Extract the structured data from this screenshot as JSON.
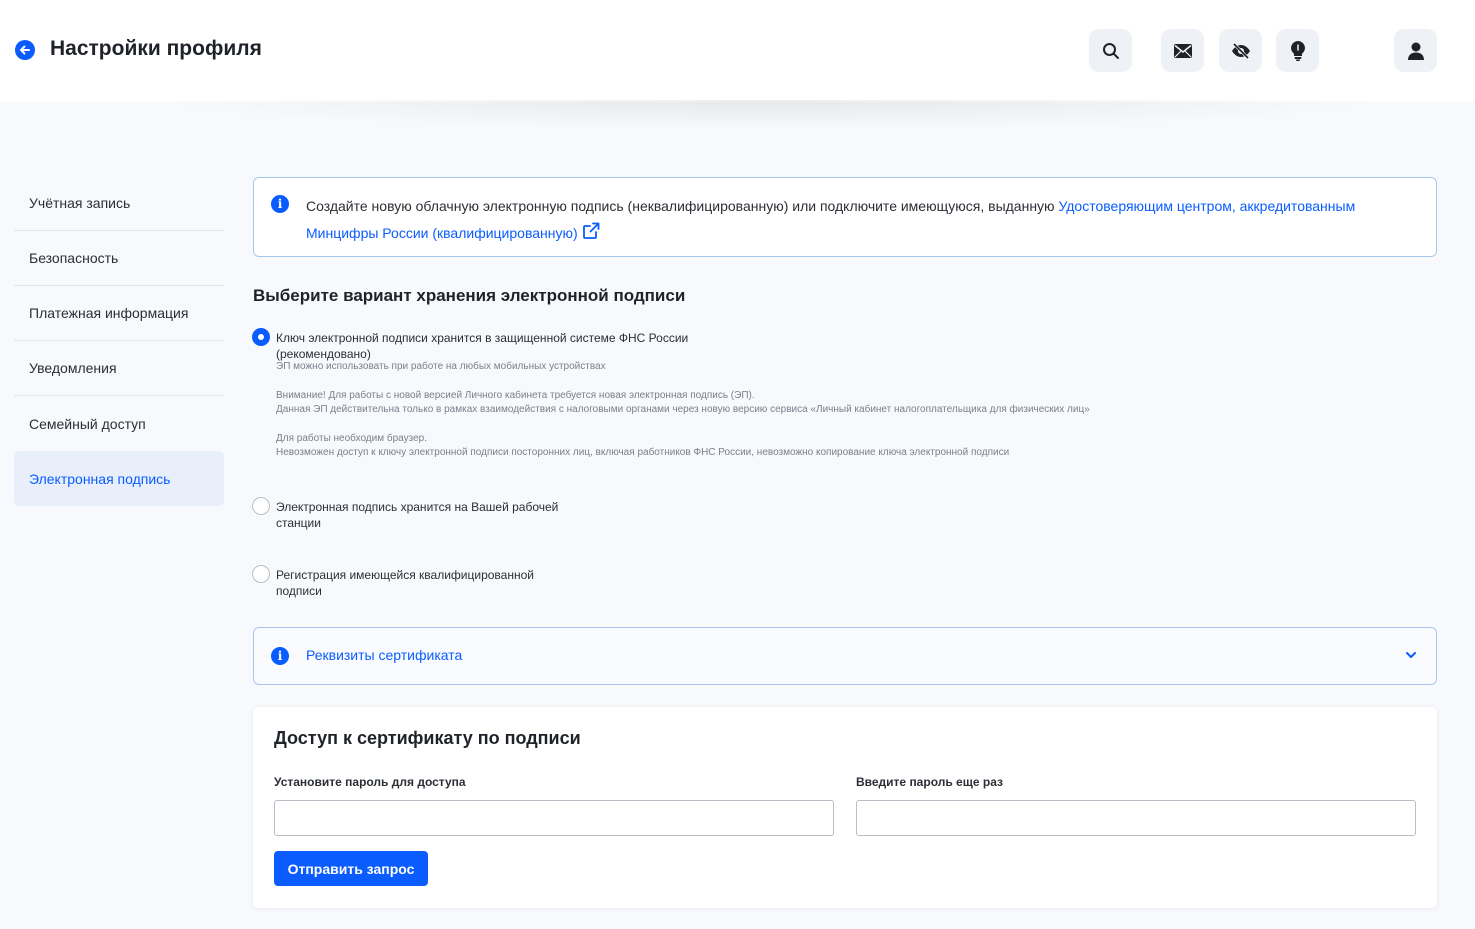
{
  "header": {
    "title": "Настройки профиля",
    "icons": [
      "search-icon",
      "mail-icon",
      "eye-off-icon",
      "lightbulb-icon",
      "user-icon"
    ]
  },
  "sidebar": {
    "items": [
      {
        "label": "Учётная запись"
      },
      {
        "label": "Безопасность"
      },
      {
        "label": "Платежная информация"
      },
      {
        "label": "Уведомления"
      },
      {
        "label": "Семейный доступ"
      },
      {
        "label": "Электронная подпись"
      }
    ],
    "active_index": 5
  },
  "info": {
    "text": "Создайте новую облачную электронную подпись (неквалифицированную) или подключите имеющуюся, выданную ",
    "link_line1": "Удостоверяющим центром, аккредитованным",
    "link_line2": "Минцифры России (квалифицированную)"
  },
  "storage": {
    "title": "Выберите вариант хранения электронной подписи",
    "option1": {
      "line1": "Ключ электронной подписи хранится в защищенной системе ФНС России",
      "line2": "(рекомендовано)",
      "checked": true,
      "notes": [
        "ЭП можно использовать при работе на любых мобильных устройствах",
        "Внимание! Для работы с новой версией Личного кабинета требуется новая электронная подпись (ЭП).",
        "Данная ЭП действительна только в рамках взаимодействия с налоговыми органами через новую версию сервиса «Личный кабинет налогоплательщика для физических лиц»",
        "Для работы необходим браузер.",
        "Невозможен доступ к ключу электронной подписи посторонних лиц, включая работников ФНС России, невозможно копирование ключа электронной подписи"
      ]
    },
    "option2": {
      "line1": "Электронная подпись хранится на Вашей рабочей",
      "line2": "станции",
      "checked": false
    },
    "option3": {
      "line1": "Регистрация имеющейся квалифицированной",
      "line2": "подписи",
      "checked": false
    }
  },
  "accordion": {
    "label": "Реквизиты сертификата"
  },
  "access": {
    "title": "Доступ к сертификату по подписи",
    "password_label": "Установите пароль для доступа",
    "password_value": "",
    "repeat_label": "Введите пароль еще раз",
    "repeat_value": "",
    "submit_label": "Отправить запрос"
  },
  "colors": {
    "accent": "#0a5cff",
    "page_bg": "#f7f9fc",
    "info_border": "#a9c6f0",
    "active_bg": "#e8effb"
  }
}
